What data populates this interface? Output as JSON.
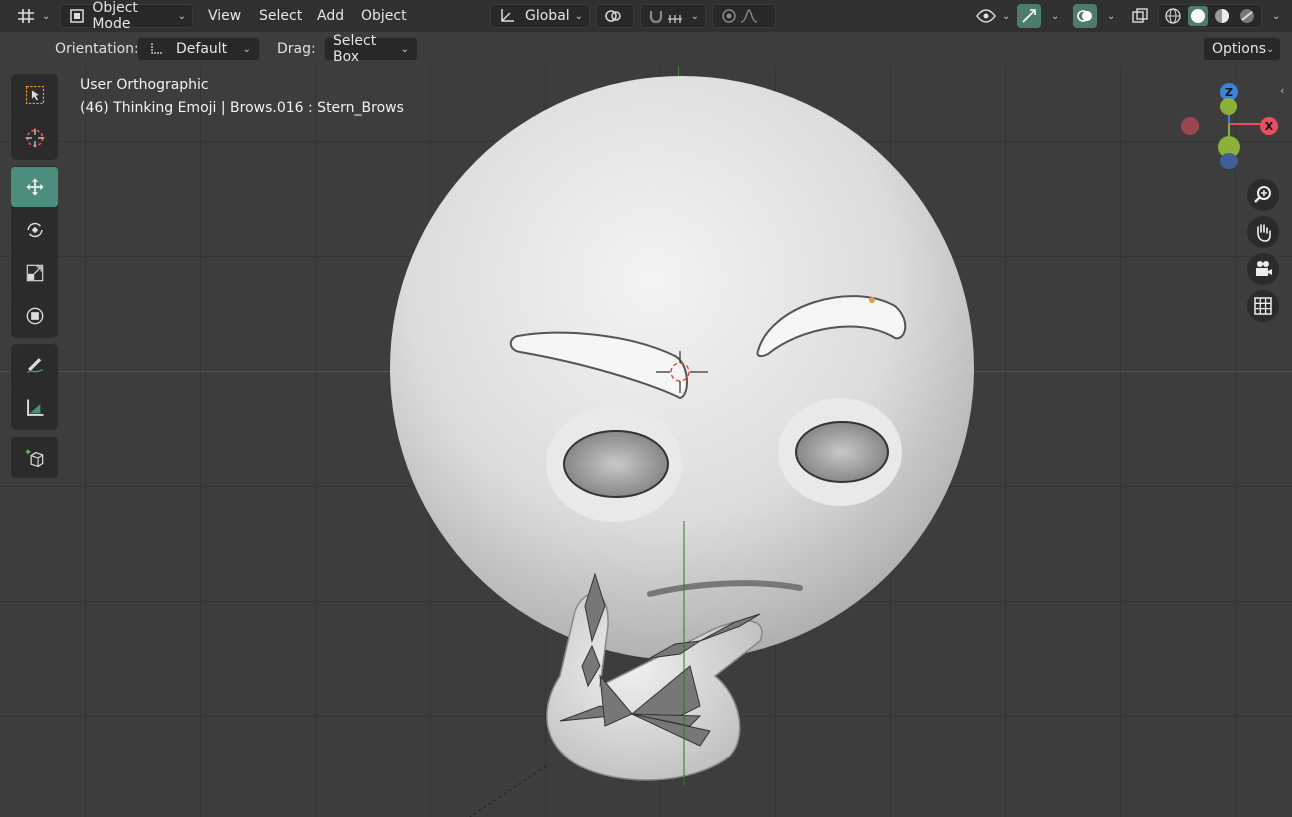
{
  "header": {
    "editor_type_icon": "editor-type-icon",
    "mode_label": "Object Mode",
    "menu": [
      "View",
      "Select",
      "Add",
      "Object"
    ],
    "transform_orientation": "Global",
    "options_label": "Options"
  },
  "tool_settings": {
    "orientation_label": "Orientation:",
    "orientation_value": "Default",
    "drag_label": "Drag:",
    "drag_value": "Select Box"
  },
  "viewport": {
    "view_name": "User Orthographic",
    "object_info": "(46) Thinking Emoji | Brows.016 : Stern_Brows"
  },
  "tools": [
    "select-box-icon",
    "cursor-icon",
    "move-icon",
    "rotate-icon",
    "scale-icon",
    "transform-icon",
    "annotate-icon",
    "measure-icon",
    "add-cube-icon"
  ],
  "gizmo": {
    "z_label": "Z",
    "x_label": "X",
    "colors": {
      "x": "#e94e5e",
      "y": "#8bb13a",
      "z": "#3a82de"
    }
  },
  "colors": {
    "active_tool": "#4b8e7e",
    "header": "#303030",
    "viewport": "#3d3d3d"
  }
}
